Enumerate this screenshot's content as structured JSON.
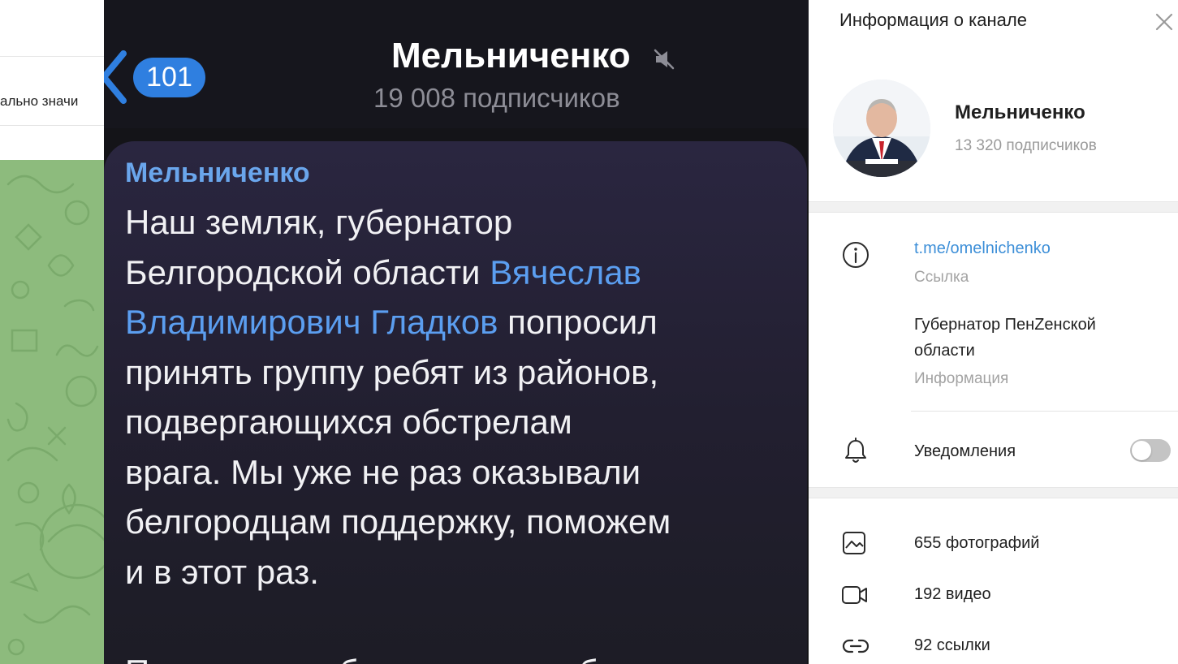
{
  "left": {
    "pinned_snippet": "ально значи"
  },
  "phone": {
    "unread_count": "101",
    "title": "Мельниченко",
    "subscribers": "19 008 подписчиков",
    "post": {
      "author": "Мельниченко",
      "lines": [
        [
          "Наш земляк, губернатор"
        ],
        [
          "Белгородской области ",
          "Вячеслав"
        ],
        [
          "Владимирович Гладков",
          " попросил"
        ],
        [
          "принять группу ребят из районов,"
        ],
        [
          "подвергающихся обстрелам"
        ],
        [
          "врага. Мы уже не раз оказывали"
        ],
        [
          "белгородцам поддержку, поможем"
        ],
        [
          "и в этот раз."
        ],
        [
          ""
        ],
        [
          "Пензенская область примет более"
        ]
      ]
    }
  },
  "panel": {
    "title": "Информация о канале",
    "name": "Мельниченко",
    "subscribers": "13 320 подписчиков",
    "link": "t.me/omelnichenko",
    "link_label": "Ссылка",
    "description": "Губернатор ПенZенской области",
    "description_label": "Информация",
    "notifications_label": "Уведомления",
    "notifications_enabled": false,
    "media": {
      "photos": "655 фотографий",
      "videos": "192 видео",
      "links": "92 ссылки"
    }
  },
  "colors": {
    "accent": "#3d8fd8",
    "badge": "#2f7fe0",
    "chat_link": "#5b9ef0",
    "author": "#6aa6ec",
    "wallpaper": "#8dbb7d"
  }
}
